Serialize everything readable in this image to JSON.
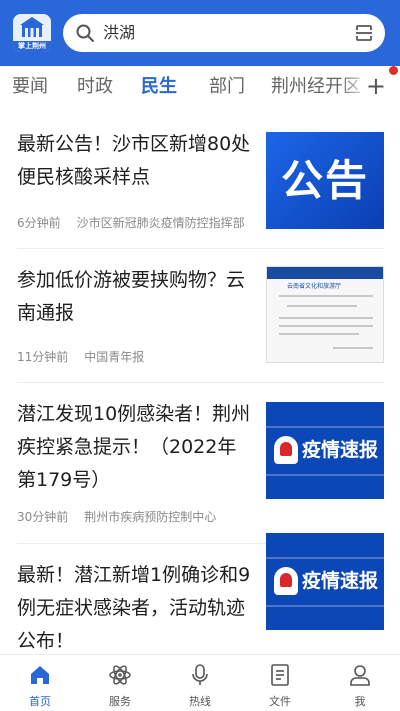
{
  "header": {
    "logo_text": "掌上荆州",
    "search_value": "洪湖",
    "colors": {
      "brand": "#2a67d9"
    }
  },
  "tabs": [
    {
      "label": "要闻"
    },
    {
      "label": "时政"
    },
    {
      "label": "民生",
      "active": true
    },
    {
      "label": "部门"
    },
    {
      "label": "荆州经开区"
    }
  ],
  "tabs_more_symbol": "+",
  "news": [
    {
      "title": "最新公告！沙市区新增80处便民核酸采样点",
      "time": "6分钟前",
      "source": "沙市区新冠肺炎疫情防控指挥部",
      "thumb_text": "公告"
    },
    {
      "title": "参加低价游被要挟购物？云南通报",
      "time": "11分钟前",
      "source": "中国青年报",
      "thumb_text": "云南省文化和旅游厅"
    },
    {
      "title": "潜江发现10例感染者！荆州疾控紧急提示！（2022年第179号）",
      "time": "30分钟前",
      "source": "荆州市疾病预防控制中心",
      "thumb_text": "疫情速报"
    },
    {
      "title": "最新！潜江新增1例确诊和9例无症状感染者，活动轨迹公布！",
      "thumb_text": "疫情速报"
    }
  ],
  "bottom_nav": [
    {
      "label": "首页",
      "icon": "home-icon",
      "active": true
    },
    {
      "label": "服务",
      "icon": "atom-icon"
    },
    {
      "label": "热线",
      "icon": "microphone-icon"
    },
    {
      "label": "文件",
      "icon": "document-icon"
    },
    {
      "label": "我",
      "icon": "user-icon"
    }
  ]
}
